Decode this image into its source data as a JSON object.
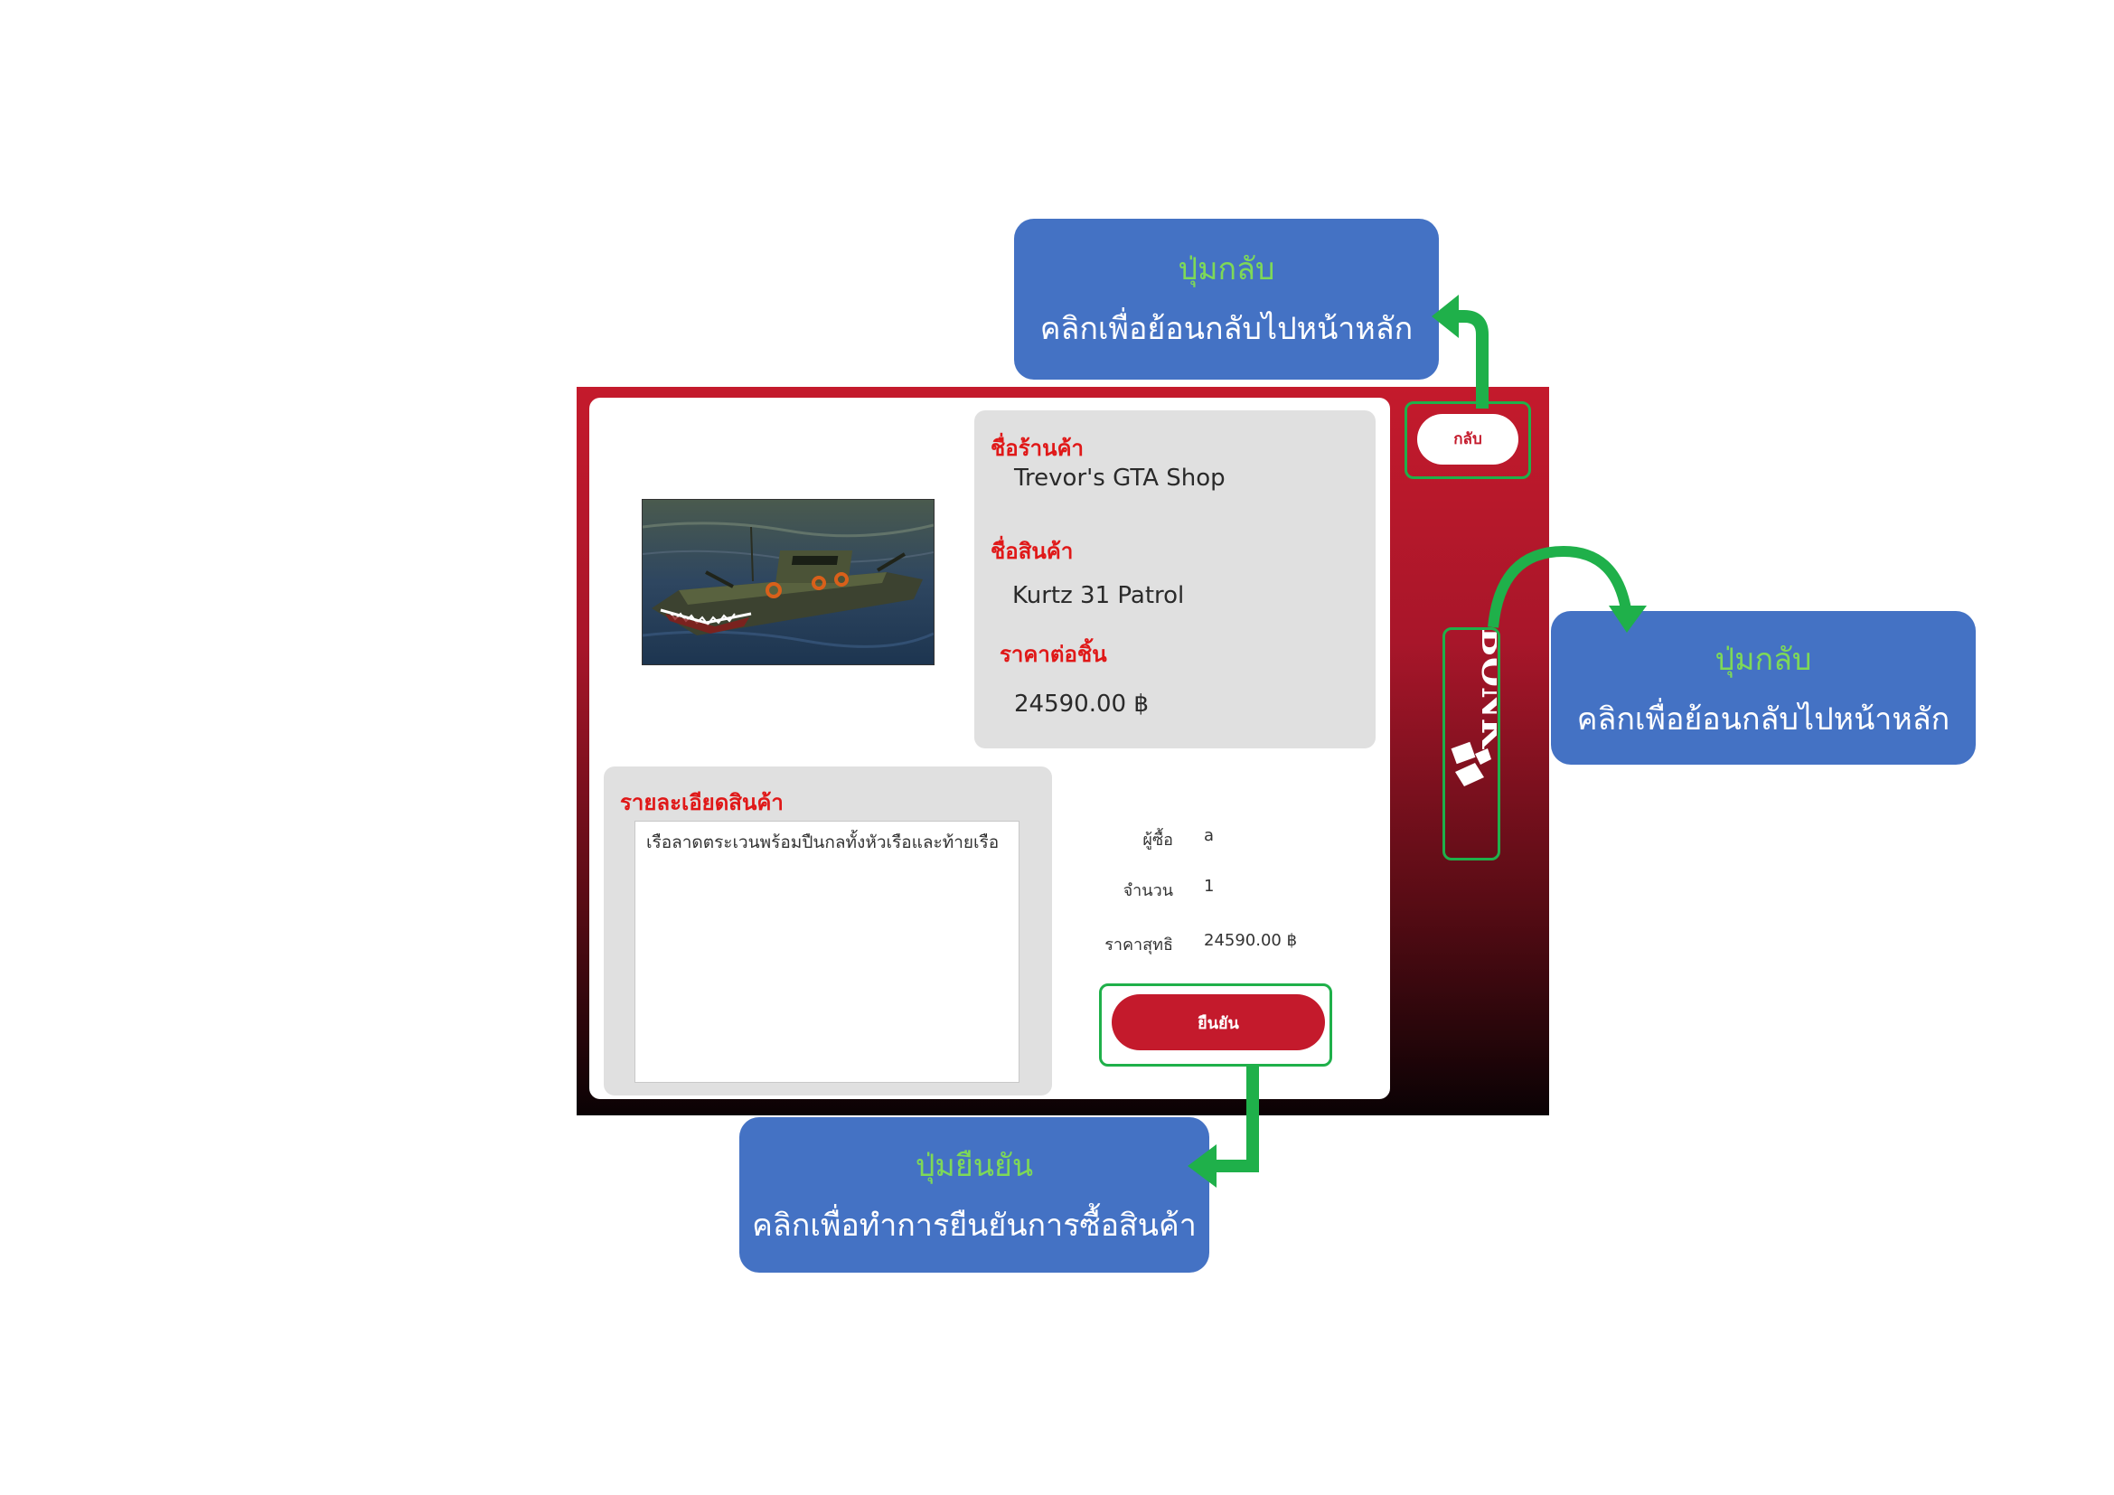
{
  "shop": {
    "name_label": "ชื่อร้านค้า",
    "name": "Trevor's GTA Shop"
  },
  "product": {
    "name_label": "ชื่อสินค้า",
    "name": "Kurtz 31 Patrol",
    "price_label": "ราคาต่อชิ้น",
    "price": "24590.00 ฿",
    "detail_label": "รายละเอียดสินค้า",
    "detail": "เรือลาดตระเวนพร้อมปืนกลทั้งหัวเรือและท้ายเรือ"
  },
  "summary": {
    "buyer_label": "ผู้ซื้อ",
    "buyer": "a",
    "qty_label": "จำนวน",
    "qty": "1",
    "total_label": "ราคาสุทธิ",
    "total": "24590.00 ฿"
  },
  "buttons": {
    "confirm": "ยืนยัน",
    "back": "กลับ"
  },
  "logo_text": "BONK",
  "callouts": {
    "back_top": {
      "title": "ปุ่มกลับ",
      "desc": "คลิกเพื่อย้อนกลับไปหน้าหลัก"
    },
    "back_right": {
      "title": "ปุ่มกลับ",
      "desc": "คลิกเพื่อย้อนกลับไปหน้าหลัก"
    },
    "confirm": {
      "title": "ปุ่มยืนยัน",
      "desc": "คลิกเพื่อทำการยืนยันการซื้อสินค้า"
    }
  },
  "colors": {
    "accent": "#c41a2c",
    "callout_bg": "#4472c4",
    "callout_title": "#7ed957",
    "highlight": "#1fb04a"
  }
}
